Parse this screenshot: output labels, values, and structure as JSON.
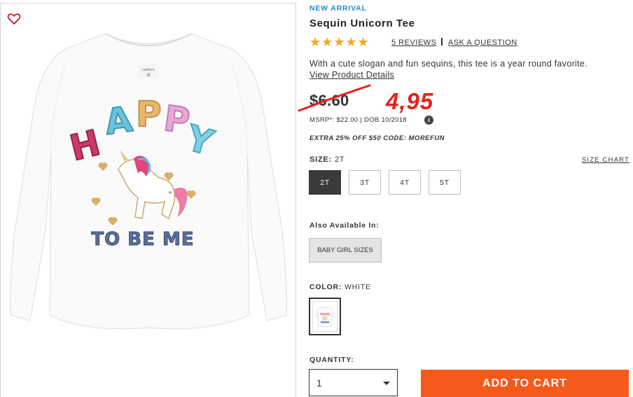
{
  "product": {
    "badge": "NEW ARRIVAL",
    "title": "Sequin Unicorn Tee",
    "rating_stars": "★★★★★",
    "rating": 5,
    "reviews_link": "5 REVIEWS",
    "ask_link": "ASK A QUESTION",
    "description": "With a cute slogan and fun sequins, this tee is a year round favorite.",
    "details_link": "View Product Details"
  },
  "pricing": {
    "old_price": "$6.60",
    "handwritten_price": "4,95",
    "msrp": "MSRP*: $22.00 | DOB 10/2018",
    "info_icon": "i",
    "promo": "EXTRA 25% OFF $50 CODE: MOREFUN"
  },
  "size": {
    "label": "SIZE:",
    "selected": "2T",
    "chart_link": "SIZE CHART",
    "options": [
      "2T",
      "3T",
      "4T",
      "5T"
    ]
  },
  "also_available": {
    "label": "Also Available In:",
    "option": "BABY GIRL SIZES"
  },
  "color": {
    "label": "COLOR:",
    "selected": "WHITE"
  },
  "quantity": {
    "label": "QUANTITY:",
    "value": "1"
  },
  "cart": {
    "button": "ADD TO CART"
  },
  "image": {
    "shirt_tag_brand": "carter's",
    "shirt_tag_size": "3t",
    "print_top": [
      "H",
      "A",
      "P",
      "P",
      "Y"
    ],
    "print_bottom": "TO BE ME"
  },
  "colors": {
    "accent_blue": "#1e8ec7",
    "star": "#f5a623",
    "cart": "#f55a1b",
    "annotation_red": "#e5231b"
  }
}
